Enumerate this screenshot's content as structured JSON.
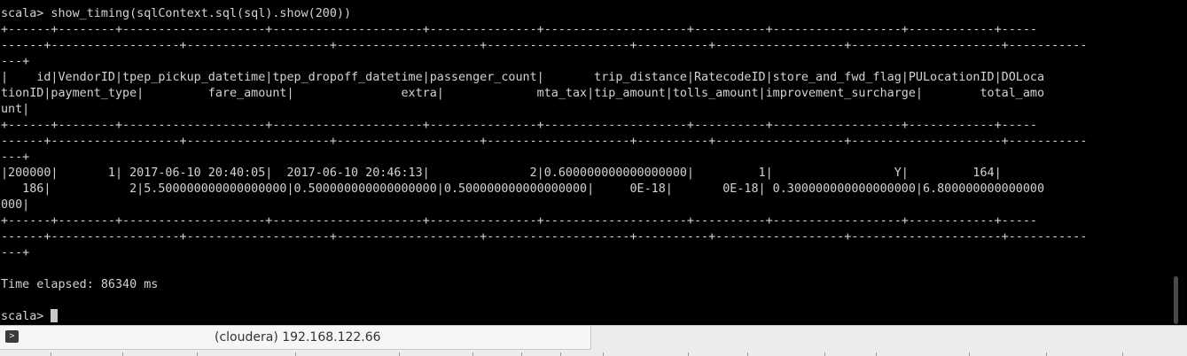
{
  "terminal": {
    "lines": [
      "scala> show_timing(sqlContext.sql(sql).show(200))",
      "+------+--------+--------------------+---------------------+---------------+--------------------+----------+------------------+------------+-----",
      "------+------------------+--------------------+--------------------+--------------------+----------+------------------+---------------------+-----------",
      "---+",
      "|    id|VendorID|tpep_pickup_datetime|tpep_dropoff_datetime|passenger_count|       trip_distance|RatecodeID|store_and_fwd_flag|PULocationID|DOLoca",
      "tionID|payment_type|         fare_amount|               extra|             mta_tax|tip_amount|tolls_amount|improvement_surcharge|        total_amo",
      "unt|",
      "+------+--------+--------------------+---------------------+---------------+--------------------+----------+------------------+------------+-----",
      "------+------------------+--------------------+--------------------+--------------------+----------+------------------+---------------------+-----------",
      "---+",
      "|200000|       1| 2017-06-10 20:40:05|  2017-06-10 20:46:13|              2|0.600000000000000000|         1|                 Y|         164|",
      "   186|           2|5.500000000000000000|0.500000000000000000|0.500000000000000000|     0E-18|       0E-18| 0.300000000000000000|6.800000000000000",
      "000|",
      "+------+--------+--------------------+---------------------+---------------+--------------------+----------+------------------+------------+-----",
      "------+------------------+--------------------+--------------------+--------------------+----------+------------------+---------------------+-----------",
      "---+",
      "",
      "Time elapsed: 86340 ms",
      ""
    ],
    "prompt": "scala> "
  },
  "statusbar": {
    "session_label": "(cloudera) 192.168.122.66",
    "icon": "terminal-icon"
  }
}
